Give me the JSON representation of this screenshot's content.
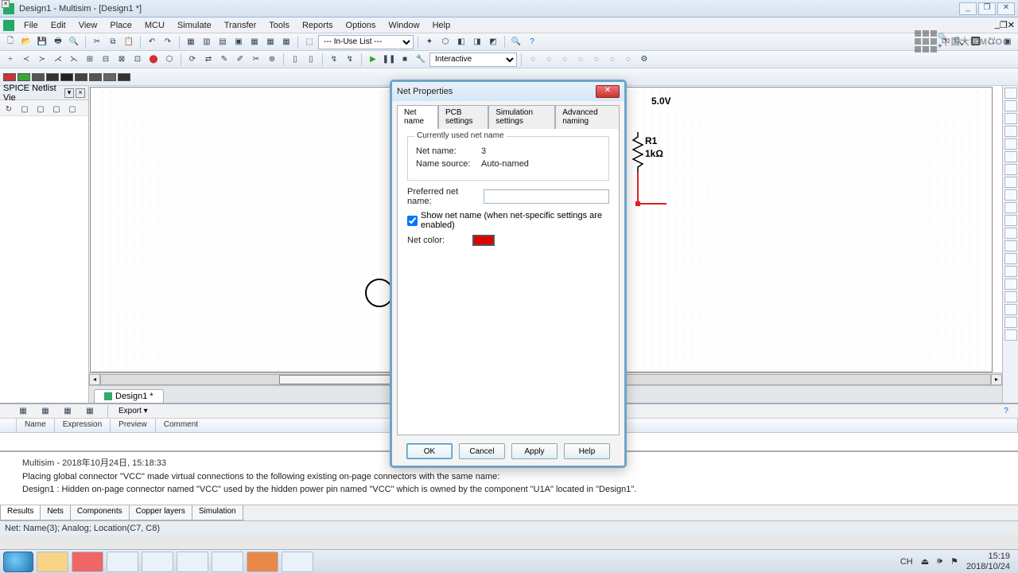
{
  "app_title": "Design1 - Multisim - [Design1 *]",
  "watermark": "中国大学MOOC",
  "window_buttons": {
    "min": "_",
    "restore": "❐",
    "close": "✕"
  },
  "menu": [
    "File",
    "Edit",
    "View",
    "Place",
    "MCU",
    "Simulate",
    "Transfer",
    "Tools",
    "Reports",
    "Options",
    "Window",
    "Help"
  ],
  "toolbar1": {
    "in_use_list": "--- In-Use List ---",
    "interactive": "Interactive"
  },
  "side_panel": {
    "title": "SPICE Netlist Vie"
  },
  "canvas": {
    "tab_label": "Design1 *",
    "voltage_label": "5.0V",
    "r_name": "R1",
    "r_value": "1kΩ"
  },
  "watch": {
    "export": "Export ▾",
    "cols": [
      "Name",
      "Expression",
      "Preview",
      "Comment"
    ]
  },
  "log": {
    "header": "Multisim  -  2018年10月24日, 15:18:33",
    "line1": "Placing global connector \"VCC\" made virtual connections to the following existing on-page connectors with the same name:",
    "line2": "Design1 : Hidden on-page connector named \"VCC\" used by the hidden power pin named \"VCC\" which is owned by the component \"U1A\" located in \"Design1\".",
    "tabs": [
      "Results",
      "Nets",
      "Components",
      "Copper layers",
      "Simulation"
    ]
  },
  "statusbar": "Net: Name(3); Analog; Location(C7, C8)",
  "dialog": {
    "title": "Net Properties",
    "tabs": [
      "Net name",
      "PCB settings",
      "Simulation settings",
      "Advanced naming"
    ],
    "group_label": "Currently used net name",
    "net_name_label": "Net name:",
    "net_name_value": "3",
    "name_source_label": "Name source:",
    "name_source_value": "Auto-named",
    "preferred_label": "Preferred net name:",
    "preferred_value": "",
    "show_checkbox": "Show net name (when net-specific settings are enabled)",
    "net_color_label": "Net color:",
    "net_color": "#e00000",
    "buttons": {
      "ok": "OK",
      "cancel": "Cancel",
      "apply": "Apply",
      "help": "Help"
    }
  },
  "taskbar": {
    "ime": "CH",
    "time": "15:19",
    "date": "2018/10/24"
  }
}
